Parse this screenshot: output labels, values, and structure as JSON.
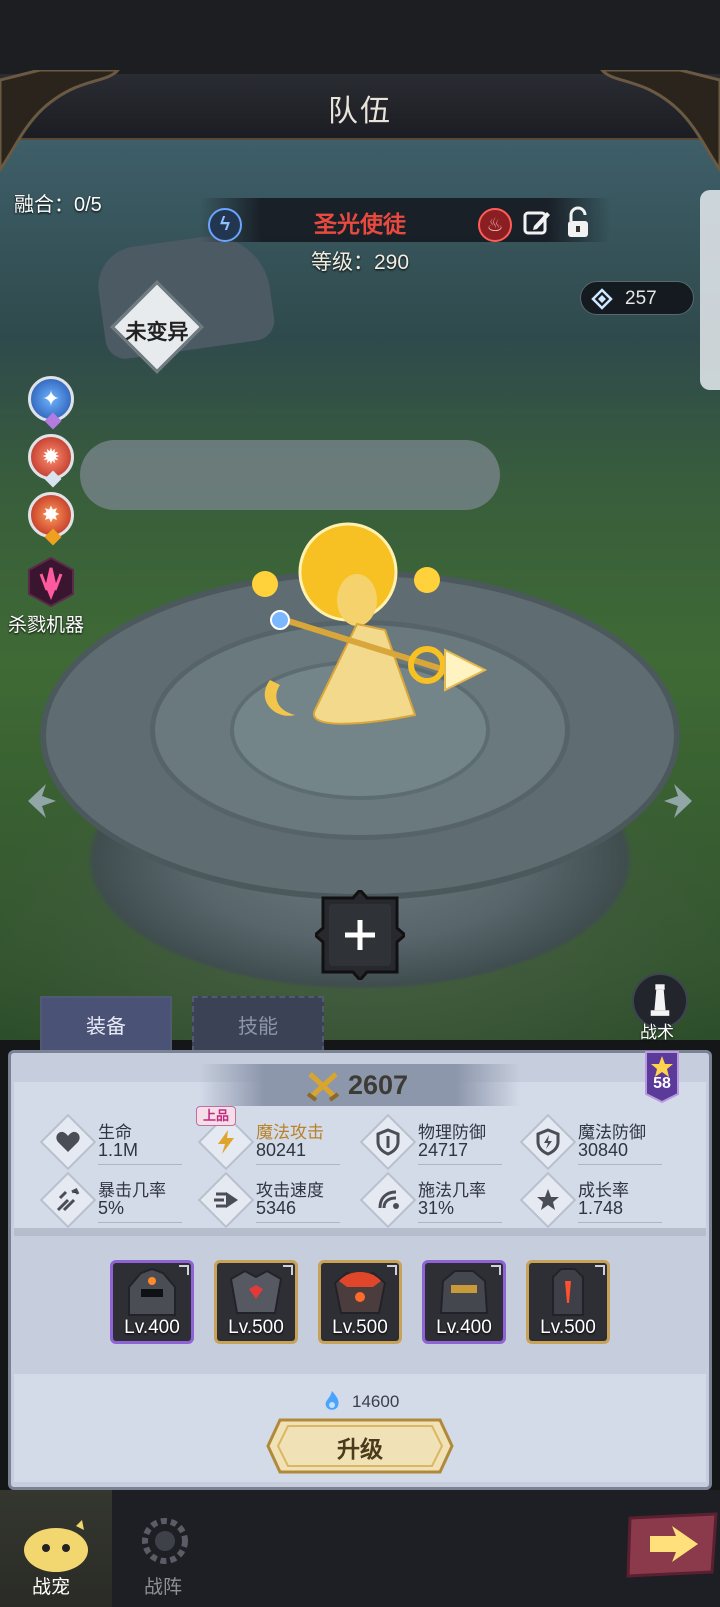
{
  "header": {
    "title": "队伍"
  },
  "hero": {
    "name": "圣光使徒",
    "level": "等级：290",
    "fusion": "融合：0/5",
    "mutation": "未变异",
    "gems": "257"
  },
  "skills": {
    "special_label": "杀戮机器"
  },
  "tactics": {
    "label": "战术"
  },
  "tabs": {
    "equip": "装备",
    "skill": "技能"
  },
  "power": {
    "value": "2607",
    "star_level": "58"
  },
  "stats": [
    {
      "name": "生命",
      "value": "1.1M",
      "icon": "heart-icon"
    },
    {
      "name": "魔法攻击",
      "value": "80241",
      "icon": "lightning-icon",
      "quality": "上品"
    },
    {
      "name": "物理防御",
      "value": "24717",
      "icon": "shield-icon"
    },
    {
      "name": "魔法防御",
      "value": "30840",
      "icon": "magic-shield-icon"
    },
    {
      "name": "暴击几率",
      "value": "5%",
      "icon": "crit-icon"
    },
    {
      "name": "攻击速度",
      "value": "5346",
      "icon": "speed-icon"
    },
    {
      "name": "施法几率",
      "value": "31%",
      "icon": "cast-icon"
    },
    {
      "name": "成长率",
      "value": "1.748",
      "icon": "growth-icon"
    }
  ],
  "equipment": [
    {
      "level": "Lv.400",
      "rarity": "purple"
    },
    {
      "level": "Lv.500",
      "rarity": "gold"
    },
    {
      "level": "Lv.500",
      "rarity": "gold"
    },
    {
      "level": "Lv.400",
      "rarity": "purple"
    },
    {
      "level": "Lv.500",
      "rarity": "gold"
    }
  ],
  "upgrade": {
    "cost": "14600",
    "label": "升级"
  },
  "nav": {
    "pet": "战宠",
    "formation": "战阵"
  },
  "colors": {
    "accent_gold": "#d9b763",
    "name_red": "#e84a3f",
    "panel": "#c6cedd"
  }
}
